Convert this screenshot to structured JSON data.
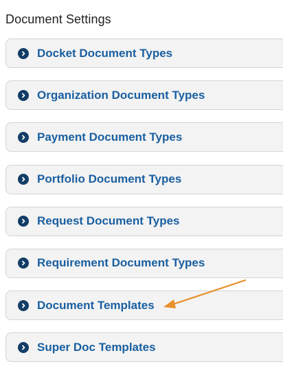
{
  "page": {
    "title": "Document Settings"
  },
  "settings": {
    "items": [
      {
        "label": "Docket Document Types",
        "icon": "chevron-right-circle-icon"
      },
      {
        "label": "Organization Document Types",
        "icon": "chevron-right-circle-icon"
      },
      {
        "label": "Payment Document Types",
        "icon": "chevron-right-circle-icon"
      },
      {
        "label": "Portfolio Document Types",
        "icon": "chevron-right-circle-icon"
      },
      {
        "label": "Request Document Types",
        "icon": "chevron-right-circle-icon"
      },
      {
        "label": "Requirement Document Types",
        "icon": "chevron-right-circle-icon"
      },
      {
        "label": "Document Templates",
        "icon": "chevron-right-circle-icon"
      },
      {
        "label": "Super Doc Templates",
        "icon": "chevron-right-circle-icon"
      }
    ]
  },
  "annotation": {
    "icon": "arrow-icon",
    "target": "Document Templates",
    "color": "#e8902a"
  },
  "colors": {
    "link_text": "#1a5fa0",
    "chevron_circle": "#123d66",
    "item_background": "#f3f3f3",
    "item_border": "#d4d4d4"
  }
}
